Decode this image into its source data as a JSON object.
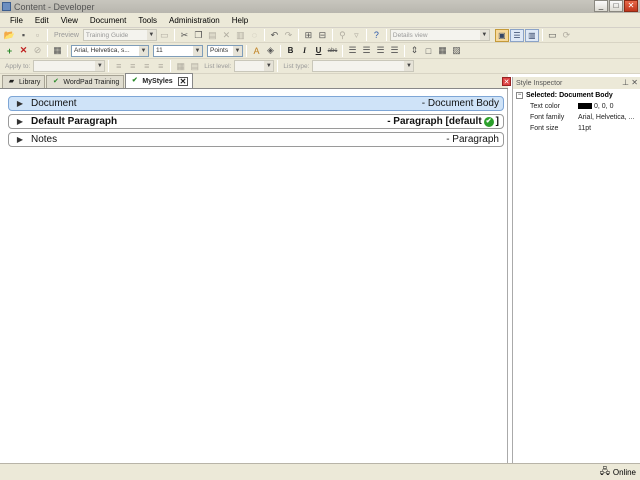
{
  "window": {
    "title": "Content - Developer",
    "buttons": [
      "_",
      "□",
      "✕"
    ]
  },
  "menu": [
    "File",
    "Edit",
    "View",
    "Document",
    "Tools",
    "Administration",
    "Help"
  ],
  "toolbar1": {
    "preview_label": "Preview",
    "project_combo": "Training Guide",
    "view_combo": "Details view"
  },
  "toolbar2": {
    "font_combo": "Arial, Helvetica, s...",
    "size_combo": "11",
    "unit_combo": "Points",
    "bold": "B",
    "italic": "I",
    "underline": "U",
    "strike": "abc"
  },
  "toolbar3": {
    "apply_to_label": "Apply to:",
    "list_level_label": "List level:",
    "list_type_label": "List type:"
  },
  "tabs": [
    {
      "label": "Library",
      "icon": "book-icon",
      "active": false,
      "closable": false
    },
    {
      "label": "WordPad Training",
      "icon": "check-icon",
      "active": false,
      "closable": false
    },
    {
      "label": "MyStyles",
      "icon": "check-icon",
      "active": true,
      "closable": true
    }
  ],
  "styles": [
    {
      "name": "Document",
      "desc": "- Document Body",
      "selected": true,
      "bold": false,
      "badge": false
    },
    {
      "name": "Default Paragraph",
      "desc": "- Paragraph [default",
      "suffix": "]",
      "selected": false,
      "bold": true,
      "badge": true
    },
    {
      "name": "Notes",
      "desc": "- Paragraph",
      "selected": false,
      "bold": false,
      "badge": false
    }
  ],
  "inspector": {
    "title": "Style Inspector",
    "selected_label": "Selected: Document Body",
    "props": [
      {
        "key": "Text color",
        "value": "0, 0, 0",
        "swatch": "#000000"
      },
      {
        "key": "Font family",
        "value": "Arial, Helvetica, ..."
      },
      {
        "key": "Font size",
        "value": "11pt"
      }
    ]
  },
  "status": {
    "text": "Online",
    "icon": "network-icon"
  },
  "colors": {
    "selection": "#cfe3f8",
    "badge": "#2ca02c"
  }
}
